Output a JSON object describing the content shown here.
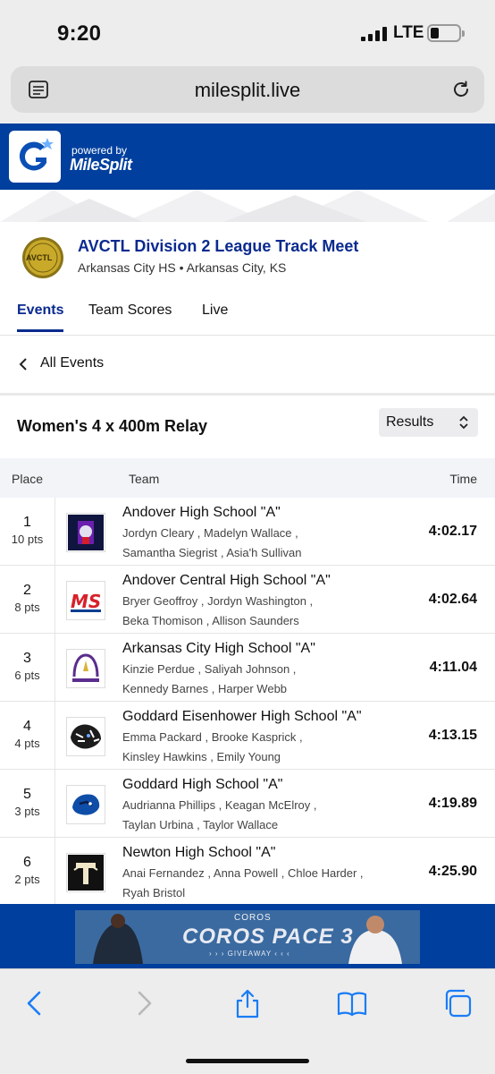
{
  "status_bar": {
    "time": "9:20",
    "network": "LTE"
  },
  "browser": {
    "url": "milesplit.live"
  },
  "brand": {
    "powered_by": "powered by",
    "name": "MileSplit"
  },
  "meet": {
    "logo_text": "AVCTL",
    "title": "AVCTL Division 2 League Track Meet",
    "location": "Arkansas City HS • Arkansas City, KS"
  },
  "tabs": [
    {
      "label": "Events",
      "active": true
    },
    {
      "label": "Team Scores",
      "active": false
    },
    {
      "label": "Live",
      "active": false
    }
  ],
  "back_link": "All Events",
  "event": {
    "title": "Women's 4 x 400m Relay",
    "view_select": "Results"
  },
  "table": {
    "headers": {
      "place": "Place",
      "team": "Team",
      "time": "Time"
    },
    "rows": [
      {
        "place": "1",
        "points": "10 pts",
        "team": "Andover High School \"A\"",
        "athletes_1": "Jordyn Cleary , Madelyn Wallace ,",
        "athletes_2": "Samantha Siegrist , Asia'h Sullivan",
        "time": "4:02.17",
        "logo": "andover-logo"
      },
      {
        "place": "2",
        "points": "8 pts",
        "team": "Andover Central High School \"A\"",
        "athletes_1": "Bryer Geoffroy , Jordyn Washington ,",
        "athletes_2": "Beka Thomison , Allison Saunders",
        "time": "4:02.64",
        "logo": "ms-logo"
      },
      {
        "place": "3",
        "points": "6 pts",
        "team": "Arkansas City High School \"A\"",
        "athletes_1": "Kinzie Perdue , Saliyah Johnson ,",
        "athletes_2": "Kennedy Barnes , Harper Webb",
        "time": "4:11.04",
        "logo": "track-field-logo"
      },
      {
        "place": "4",
        "points": "4 pts",
        "team": "Goddard Eisenhower High School \"A\"",
        "athletes_1": "Emma Packard , Brooke Kasprick ,",
        "athletes_2": "Kinsley Hawkins , Emily Young",
        "time": "4:13.15",
        "logo": "tiger-logo"
      },
      {
        "place": "5",
        "points": "3 pts",
        "team": "Goddard High School \"A\"",
        "athletes_1": "Audrianna Phillips , Keagan McElroy ,",
        "athletes_2": "Taylan Urbina , Taylor Wallace",
        "time": "4:19.89",
        "logo": "panther-logo"
      },
      {
        "place": "6",
        "points": "2 pts",
        "team": "Newton High School \"A\"",
        "athletes_1": "Anai Fernandez , Anna Powell , Chloe Harder ,",
        "athletes_2": "Ryah Bristol",
        "time": "4:25.90",
        "logo": "newton-logo"
      }
    ]
  },
  "ad": {
    "brand": "COROS",
    "title": "COROS PACE 3",
    "subtitle": "› › › GIVEAWAY ‹ ‹ ‹"
  },
  "colors": {
    "brand_blue": "#003f9e",
    "title_blue": "#0a2a8f",
    "ios_blue": "#1a7cf5"
  }
}
